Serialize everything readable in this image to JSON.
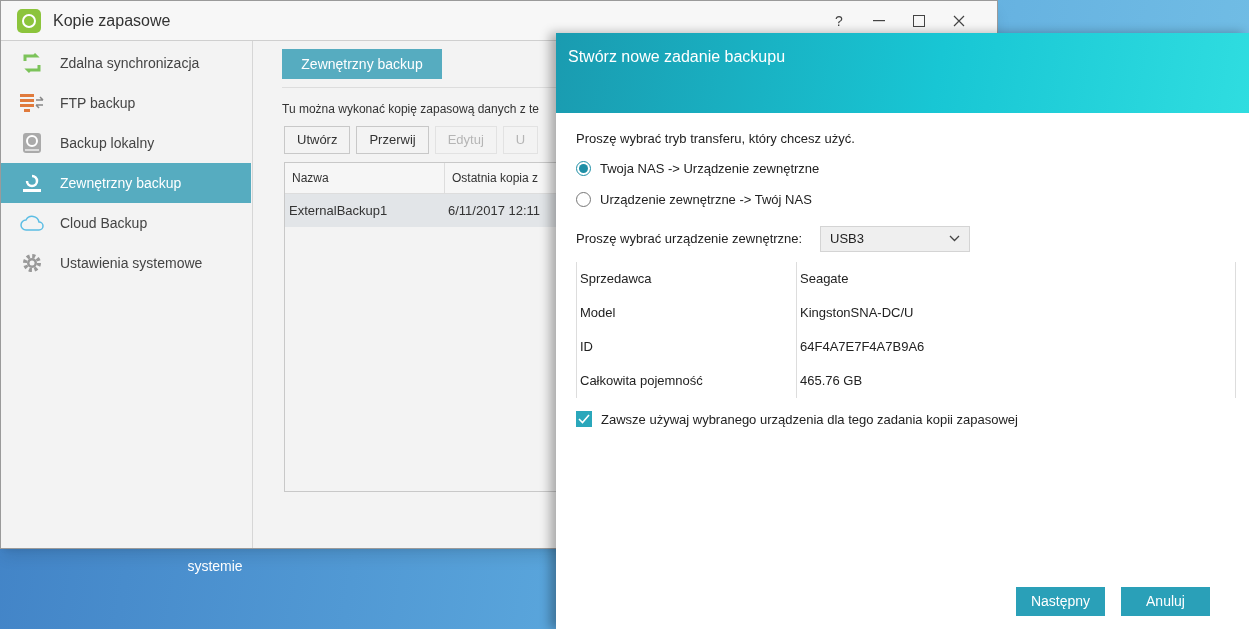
{
  "desktop": {
    "icon_labels": [
      "systemie"
    ]
  },
  "window": {
    "title": "Kopie zapasowe",
    "controls": [
      {
        "kind": "help",
        "label": "?"
      },
      {
        "kind": "minimize"
      },
      {
        "kind": "maximize"
      },
      {
        "kind": "close"
      }
    ]
  },
  "sidebar": {
    "items": [
      {
        "label": "Zdalna synchronizacja",
        "kind": "sync",
        "selected": false
      },
      {
        "label": "FTP backup",
        "kind": "ftp",
        "selected": false
      },
      {
        "label": "Backup lokalny",
        "kind": "disk",
        "selected": false
      },
      {
        "label": "Zewnętrzny backup",
        "kind": "external",
        "selected": true
      },
      {
        "label": "Cloud Backup",
        "kind": "cloud",
        "selected": false
      },
      {
        "label": "Ustawienia systemowe",
        "kind": "gear",
        "selected": false
      }
    ]
  },
  "content": {
    "tab": "Zewnętrzny backup",
    "description": "Tu można wykonać kopię zapasową danych z te",
    "toolbar": [
      {
        "label": "Utwórz",
        "disabled": false
      },
      {
        "label": "Przerwij",
        "disabled": false
      },
      {
        "label": "Edytuj",
        "disabled": true
      },
      {
        "label": "U",
        "disabled": true
      }
    ],
    "table": {
      "columns": [
        "Nazwa",
        "Ostatnia kopia z"
      ],
      "rows": [
        {
          "cells": [
            "ExternalBackup1",
            "6/11/2017 12:11"
          ],
          "selected": true
        }
      ]
    }
  },
  "dialog": {
    "title": "Stwórz nowe zadanie backupu",
    "prompt": "Proszę wybrać tryb transferu, który chcesz użyć.",
    "modes": [
      {
        "label": "Twoja NAS -> Urządzenie zewnętrzne",
        "selected": true
      },
      {
        "label": "Urządzenie zewnętrzne -> Twój NAS",
        "selected": false
      }
    ],
    "device_label": "Proszę wybrać urządzenie zewnętrzne:",
    "device": "USB3",
    "info": [
      {
        "label": "Sprzedawca",
        "value": "Seagate"
      },
      {
        "label": "Model",
        "value": "KingstonSNA-DC/U"
      },
      {
        "label": "ID",
        "value": "64F4A7E7F4A7B9A6"
      },
      {
        "label": "Całkowita pojemność",
        "value": "465.76 GB"
      }
    ],
    "always_use": {
      "label": "Zawsze używaj wybranego urządzenia dla tego zadania kopii zapasowej",
      "checked": true
    },
    "buttons": [
      "Następny",
      "Anuluj"
    ]
  }
}
